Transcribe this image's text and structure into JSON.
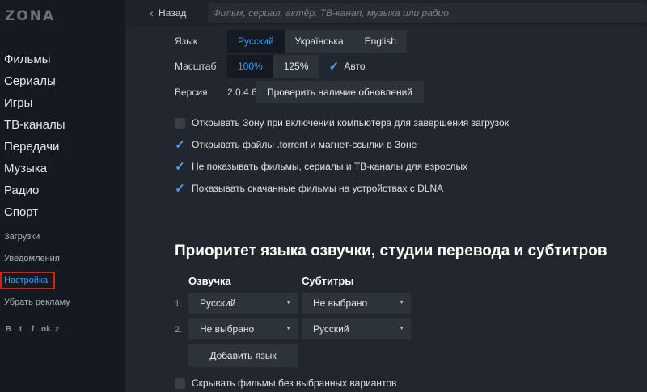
{
  "sidebar": {
    "logo": "ZONA",
    "main_items": [
      "Фильмы",
      "Сериалы",
      "Игры",
      "ТВ-каналы",
      "Передачи",
      "Музыка",
      "Радио",
      "Спорт"
    ],
    "sub_items": [
      "Загрузки",
      "Уведомления",
      "Настройка",
      "Убрать рекламу"
    ],
    "active_item": "Настройка",
    "socials": [
      "В",
      "t",
      "f",
      "ok",
      "z"
    ]
  },
  "topbar": {
    "back_label": "Назад",
    "search_placeholder": "Фильм, сериал, актёр, ТВ-канал, музыка или радио"
  },
  "settings": {
    "language_label": "Язык",
    "languages": [
      "Русский",
      "Українська",
      "English"
    ],
    "language_selected": "Русский",
    "scale_label": "Масштаб",
    "scales": [
      "100%",
      "125%"
    ],
    "scale_selected": "100%",
    "auto_label": "Авто",
    "auto_checked": true,
    "version_label": "Версия",
    "version_value": "2.0.4.6",
    "check_updates_label": "Проверить наличие обновлений",
    "options": [
      {
        "label": "Открывать Зону при включении компьютера для завершения загрузок",
        "checked": false
      },
      {
        "label": "Открывать файлы .torrent и магнет-ссылки в Зоне",
        "checked": true
      },
      {
        "label": "Не показывать фильмы, сериалы и ТВ-каналы для взрослых",
        "checked": true
      },
      {
        "label": "Показывать скачанные фильмы на устройствах с DLNA",
        "checked": true
      }
    ]
  },
  "priority": {
    "title": "Приоритет языка озвучки, студии перевода и субтитров",
    "voice_header": "Озвучка",
    "subs_header": "Субтитры",
    "rows": [
      {
        "num": "1.",
        "voice": "Русский",
        "subs": "Не выбрано"
      },
      {
        "num": "2.",
        "voice": "Не выбрано",
        "subs": "Русский"
      }
    ],
    "add_language_label": "Добавить язык",
    "hide_films_label": "Скрывать фильмы без выбранных вариантов",
    "hide_films_checked": false
  },
  "colors": {
    "accent": "#3b9cff",
    "highlight_border": "#e31b1b"
  }
}
